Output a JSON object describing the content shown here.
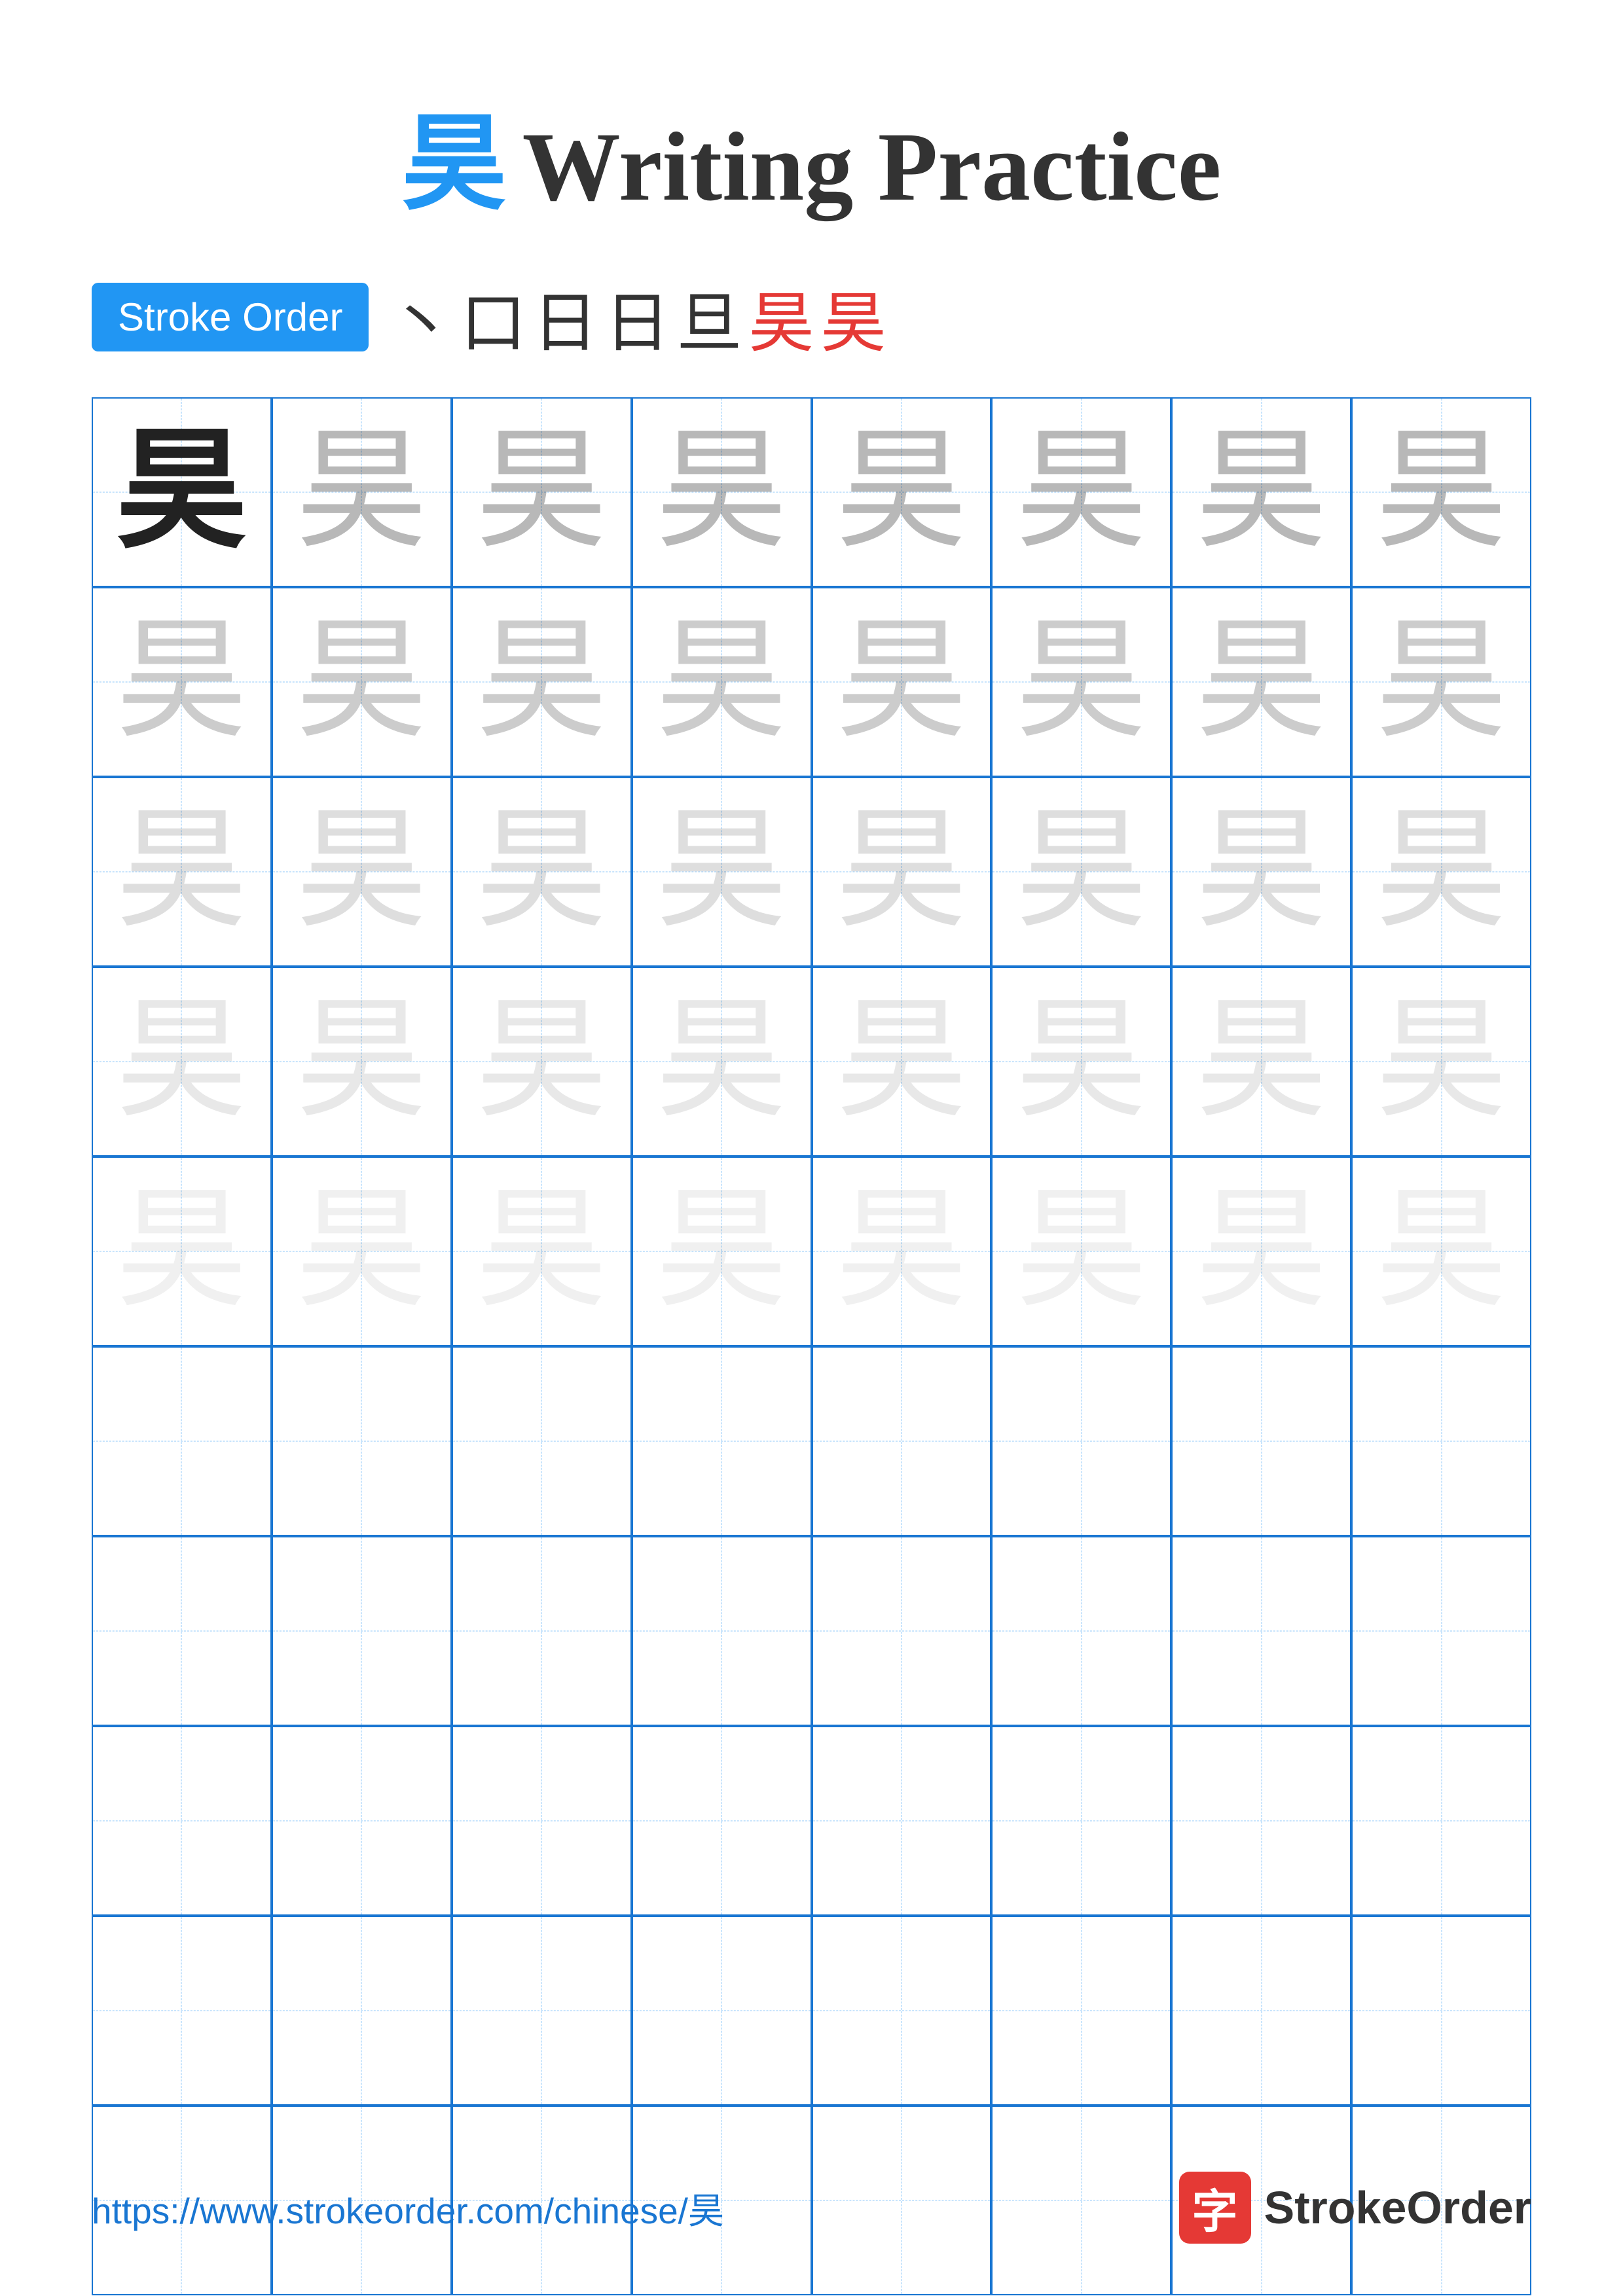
{
  "title": {
    "chinese": "昊",
    "english": "Writing Practice"
  },
  "stroke_order": {
    "badge_label": "Stroke Order",
    "strokes": [
      "丶",
      "口",
      "日",
      "日",
      "旦",
      "昊",
      "昊"
    ]
  },
  "grid": {
    "rows": 10,
    "cols": 8,
    "character": "昊",
    "opacity_rows": [
      "bold",
      "light-1",
      "light-2",
      "light-3",
      "light-4",
      "empty",
      "empty",
      "empty",
      "empty",
      "empty"
    ]
  },
  "footer": {
    "url": "https://www.strokeorder.com/chinese/昊",
    "brand_icon": "字",
    "brand_name": "StrokeOrder"
  }
}
